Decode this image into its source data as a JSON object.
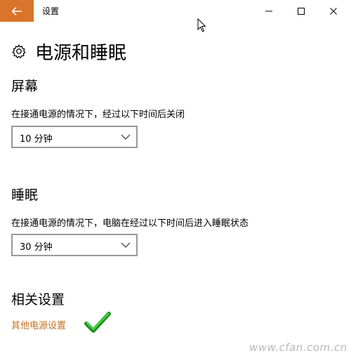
{
  "window": {
    "title": "设置"
  },
  "page": {
    "title": "电源和睡眠"
  },
  "screen": {
    "title": "屏幕",
    "description": "在接通电源的情况下，经过以下时间后关闭",
    "selected": "10 分钟"
  },
  "sleep": {
    "title": "睡眠",
    "description": "在接通电源的情况下，电脑在经过以下时间后进入睡眠状态",
    "selected": "30 分钟"
  },
  "related": {
    "title": "相关设置",
    "link_label": "其他电源设置"
  },
  "watermark": "www.cfan.com.cn",
  "colors": {
    "accent": "#d9742a",
    "link": "#c2711f",
    "check": "#2db52d"
  },
  "icons": [
    "back-arrow-icon",
    "minimize-icon",
    "maximize-icon",
    "close-icon",
    "gear-icon",
    "chevron-down-icon",
    "checkmark-icon",
    "mouse-cursor-icon"
  ]
}
